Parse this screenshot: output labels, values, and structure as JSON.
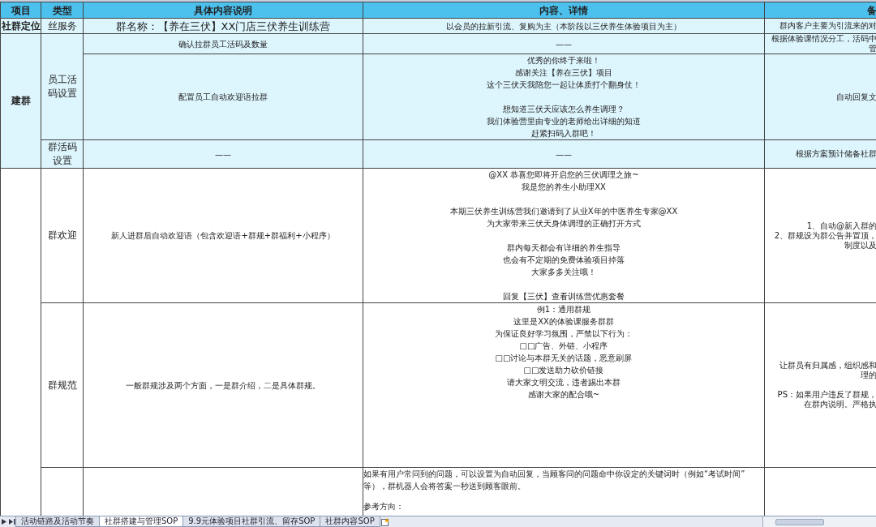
{
  "columns": [
    "项目",
    "类型",
    "具体内容说明",
    "内容、详情",
    "备"
  ],
  "sections": [
    {
      "project": "社群定位",
      "shaded": true,
      "groups": [
        {
          "type": "丝服务",
          "rows": [
            {
              "content": "群名称：【养在三伏】XX门店三伏养生训练营",
              "detail": [
                [
                  "以会员的拉新引流、复购为主（本阶段以三伏养生体验项目为主）"
                ]
              ],
              "remark": [
                [
                  "群内客户主要为引流来的对"
                ]
              ]
            }
          ]
        }
      ]
    },
    {
      "project": "建群",
      "shaded": true,
      "groups": [
        {
          "type": "员工活码设置",
          "rows": [
            {
              "content": "确认拉群员工活码及数量",
              "detail": [
                [
                  "——"
                ]
              ],
              "remark": [
                [
                  "根据体验课情况分工，活码中",
                  "管"
                ]
              ]
            },
            {
              "content": "配置员工自动欢迎语拉群",
              "detail": [
                [
                  "优秀的你终于来啦！",
                  "感谢关注【养在三伏】项目",
                  "这个三伏天我陪您一起让体质打个翻身仗！"
                ],
                [
                  "想知道三伏天应该怎么养生调理？",
                  "我们体验营里由专业的老师给出详细的知道",
                  "赶紧扫码入群吧！"
                ]
              ],
              "remark": [
                [
                  "自动回复文"
                ]
              ]
            }
          ]
        },
        {
          "type": "群活码设置",
          "rows": [
            {
              "content": "——",
              "detail": [
                [
                  "——"
                ]
              ],
              "remark": [
                [
                  "根据方案预计储备社群"
                ]
              ]
            }
          ]
        }
      ]
    },
    {
      "shaded": false,
      "groups": [
        {
          "type": "群欢迎",
          "rows": [
            {
              "content": "新人进群后自动欢迎语（包含欢迎语+群规+群福利+小程序）",
              "detail": [
                [
                  "@XX  恭喜您即将开启您的三伏调理之旅~",
                  "我是您的养生小助理XX"
                ],
                [
                  "本期三伏养生训练营我们邀请到了从业X年的中医养生专家@XX",
                  "为大家带来三伏天身体调理的正确打开方式"
                ],
                [
                  "群内每天都会有详细的养生指导",
                  "也会有不定期的免费体验项目掉落",
                  "大家多多关注哦！"
                ],
                [
                  "回复【三伏】查看训练营优惠套餐"
                ]
              ],
              "remark": [
                [
                  "1、自动@新入群的",
                  "2、群规设为群公告并置顶，",
                  "制度以及"
                ]
              ]
            }
          ]
        },
        {
          "type": "群规范",
          "rows": [
            {
              "content": "一般群规涉及两个方面，一是群介绍，二是具体群规。",
              "detail": [
                [
                  "例1：通用群规",
                  "这里是XX的体验课服务群群",
                  "为保证良好学习氛围，严禁以下行为：",
                  "□□广告、外链、小程序",
                  "□□讨论与本群无关的话题，恶意刷屏",
                  "□□发送助力砍价链接",
                  "请大家文明交流，违者踢出本群",
                  "感谢大家的配合哦~"
                ]
              ],
              "remark": [
                [
                  "让群员有归属感，组织感和",
                  "理的"
                ],
                [
                  "PS：如果用户违反了群规，",
                  "在群内说明。严格执"
                ]
              ]
            }
          ]
        },
        {
          "rows": [
            {
              "detail": [
                [
                  "如果有用户常问到的问题，可以设置为自动回复，当顾客问的问题命中你设定的关键词时（例如“考试时间”",
                  "等），群机器人会将答案一秒送到顾客眼前。"
                ],
                [
                  "参考方向："
                ]
              ]
            }
          ]
        }
      ]
    }
  ],
  "sheet_tabs": [
    {
      "label": "活动链路及活动节奏",
      "selected": false
    },
    {
      "label": "社群搭建与管理SOP",
      "selected": true
    },
    {
      "label": "9.9元体验项目社群引流、留存SOP",
      "selected": false
    },
    {
      "label": "社群内容SOP",
      "selected": false
    }
  ]
}
